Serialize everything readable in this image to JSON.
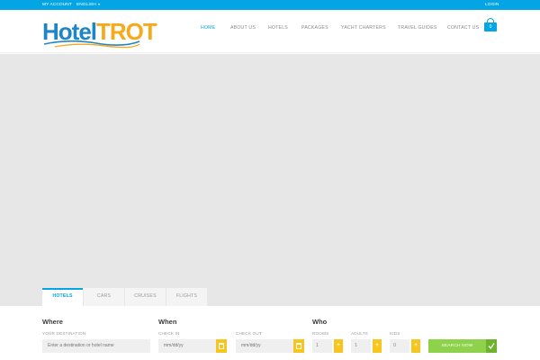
{
  "topbar": {
    "my_account": "MY ACCOUNT",
    "language": "ENGLISH",
    "login": "LOGIN"
  },
  "brand": {
    "logo_part1": "Hotel",
    "logo_part2": "TROT",
    "colors": {
      "primary": "#04a5e5",
      "logo_blue": "#1e86c8",
      "logo_orange": "#f7a81b"
    }
  },
  "nav": {
    "items": [
      "HOME",
      "ABOUT US",
      "HOTELS",
      "PACKAGES",
      "YACHT CHARTERS",
      "TRAVEL GUIDES",
      "CONTACT US"
    ],
    "active": "HOME"
  },
  "cart": {
    "count": "0",
    "icon": "shopping-basket-icon"
  },
  "tabs": {
    "items": [
      "HOTELS",
      "CARS",
      "CRUISES",
      "FLIGHTS"
    ],
    "active": "HOTELS"
  },
  "search": {
    "where_title": "Where",
    "destination_label": "YOUR DESTINATION",
    "destination_placeholder": "Enter a destination or hotel name",
    "when_title": "When",
    "checkin_label": "CHECK IN",
    "checkin_placeholder": "mm/dd/yy",
    "checkout_label": "CHECK OUT",
    "checkout_placeholder": "mm/dd/yy",
    "who_title": "Who",
    "rooms_label": "ROOMS",
    "rooms_value": "1",
    "adults_label": "ADULTS",
    "adults_value": "1",
    "kids_label": "KIDS",
    "kids_value": "0",
    "stepper_symbol": "+",
    "button_label": "SEARCH NOW",
    "colors": {
      "date_button": "#f7c51e",
      "search_button": "#8ed14a"
    }
  }
}
